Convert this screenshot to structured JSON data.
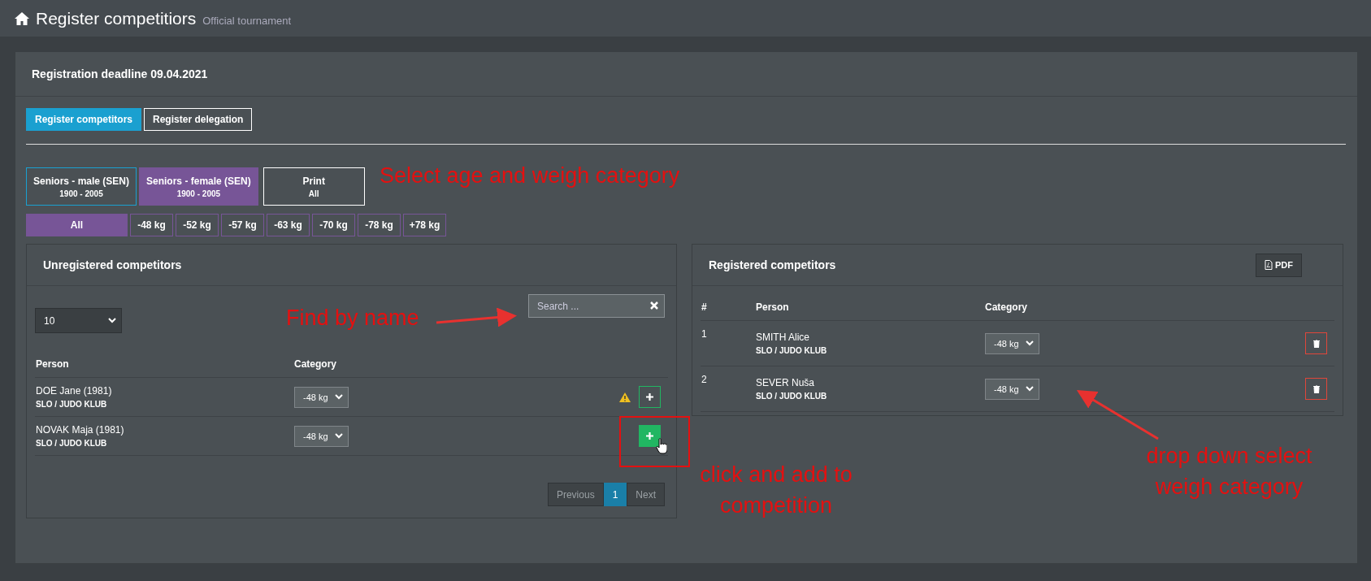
{
  "header": {
    "title": "Register competitiors",
    "subtitle": "Official tournament"
  },
  "deadline": "Registration deadline 09.04.2021",
  "tabs": [
    {
      "label": "Register competitors",
      "selected": true
    },
    {
      "label": "Register delegation",
      "selected": false
    }
  ],
  "age_groups": [
    {
      "kind": "group",
      "label": "Seniors - male (SEN)",
      "sublabel": "1900 - 2005",
      "selected": false
    },
    {
      "kind": "group",
      "label": "Seniors - female (SEN)",
      "sublabel": "1900 - 2005",
      "selected": true
    },
    {
      "kind": "print",
      "label": "Print",
      "sublabel": "All",
      "selected": false
    }
  ],
  "weights": [
    {
      "label": "All",
      "selected": true
    },
    {
      "label": "-48 kg",
      "selected": false
    },
    {
      "label": "-52 kg",
      "selected": false
    },
    {
      "label": "-57 kg",
      "selected": false
    },
    {
      "label": "-63 kg",
      "selected": false
    },
    {
      "label": "-70 kg",
      "selected": false
    },
    {
      "label": "-78 kg",
      "selected": false
    },
    {
      "label": "+78 kg",
      "selected": false
    }
  ],
  "unregistered": {
    "title": "Unregistered competitors",
    "page_size": "10",
    "search": {
      "placeholder": "Search ..."
    },
    "columns": [
      "Person",
      "Category"
    ],
    "rows": [
      {
        "name": "DOE Jane (1981)",
        "club": "SLO / JUDO KLUB",
        "category": "-48 kg",
        "warning": true,
        "hovered": false
      },
      {
        "name": "NOVAK Maja (1981)",
        "club": "SLO / JUDO KLUB",
        "category": "-48 kg",
        "warning": false,
        "hovered": true
      }
    ],
    "pagination": [
      {
        "label": "Previous",
        "selected": false
      },
      {
        "label": "1",
        "selected": true
      },
      {
        "label": "Next",
        "selected": false
      }
    ]
  },
  "registered": {
    "title": "Registered competitors",
    "pdf": "PDF",
    "columns": [
      "#",
      "Person",
      "Category"
    ],
    "rows": [
      {
        "number": "1",
        "name": "SMITH Alice",
        "club": "SLO / JUDO KLUB",
        "category": "-48 kg"
      },
      {
        "number": "2",
        "name": "SEVER Nuša",
        "club": "SLO / JUDO KLUB",
        "category": "-48 kg"
      }
    ]
  },
  "annotations": [
    {
      "text": "Select age and weigh category"
    },
    {
      "text": "Find by name"
    },
    {
      "text": "click and add to competition"
    },
    {
      "text": "drop down select weigh category"
    }
  ]
}
